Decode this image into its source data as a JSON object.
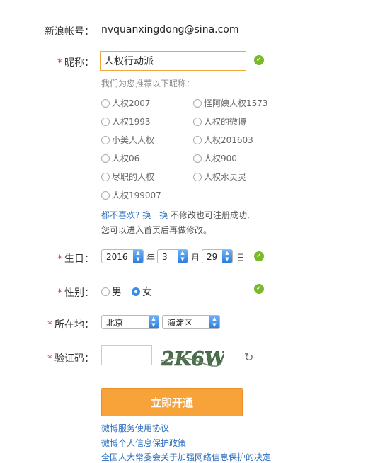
{
  "account": {
    "label": "新浪帐号：",
    "value": "nvquanxingdong@sina.com"
  },
  "nickname": {
    "required_mark": "*",
    "label": "昵称：",
    "value": "人权行动派",
    "hint": "我们为您推荐以下昵称：",
    "suggestions": [
      "人权2007",
      "怪阿姨人权1573",
      "人权1993",
      "人权的微博",
      "小美人人权",
      "人权201603",
      "人权06",
      "人权900",
      "尽职的人权",
      "人权水灵灵",
      "人权199007"
    ],
    "dislike_text": "都不喜欢?",
    "change_link": "换一换",
    "no_change_text": "不修改也可注册成功,",
    "later_text": "您可以进入首页后再做修改。"
  },
  "birthday": {
    "required_mark": "*",
    "label": "生日：",
    "year": "2016",
    "year_unit": "年",
    "month": "3",
    "month_unit": "月",
    "day": "29",
    "day_unit": "日"
  },
  "gender": {
    "required_mark": "*",
    "label": "性别：",
    "male": "男",
    "female": "女",
    "selected": "女"
  },
  "location": {
    "required_mark": "*",
    "label": "所在地：",
    "province": "北京",
    "district": "海淀区"
  },
  "captcha": {
    "required_mark": "*",
    "label": "验证码：",
    "image_text": "2K6W",
    "value": ""
  },
  "submit_label": "立即开通",
  "footer_links": [
    "微博服务使用协议",
    "微博个人信息保护政策",
    "全国人大常委会关于加强网络信息保护的决定"
  ],
  "colors": {
    "accent": "#f7a33a",
    "link": "#2a6dbf",
    "success": "#7ab929",
    "required": "#e4393c"
  }
}
